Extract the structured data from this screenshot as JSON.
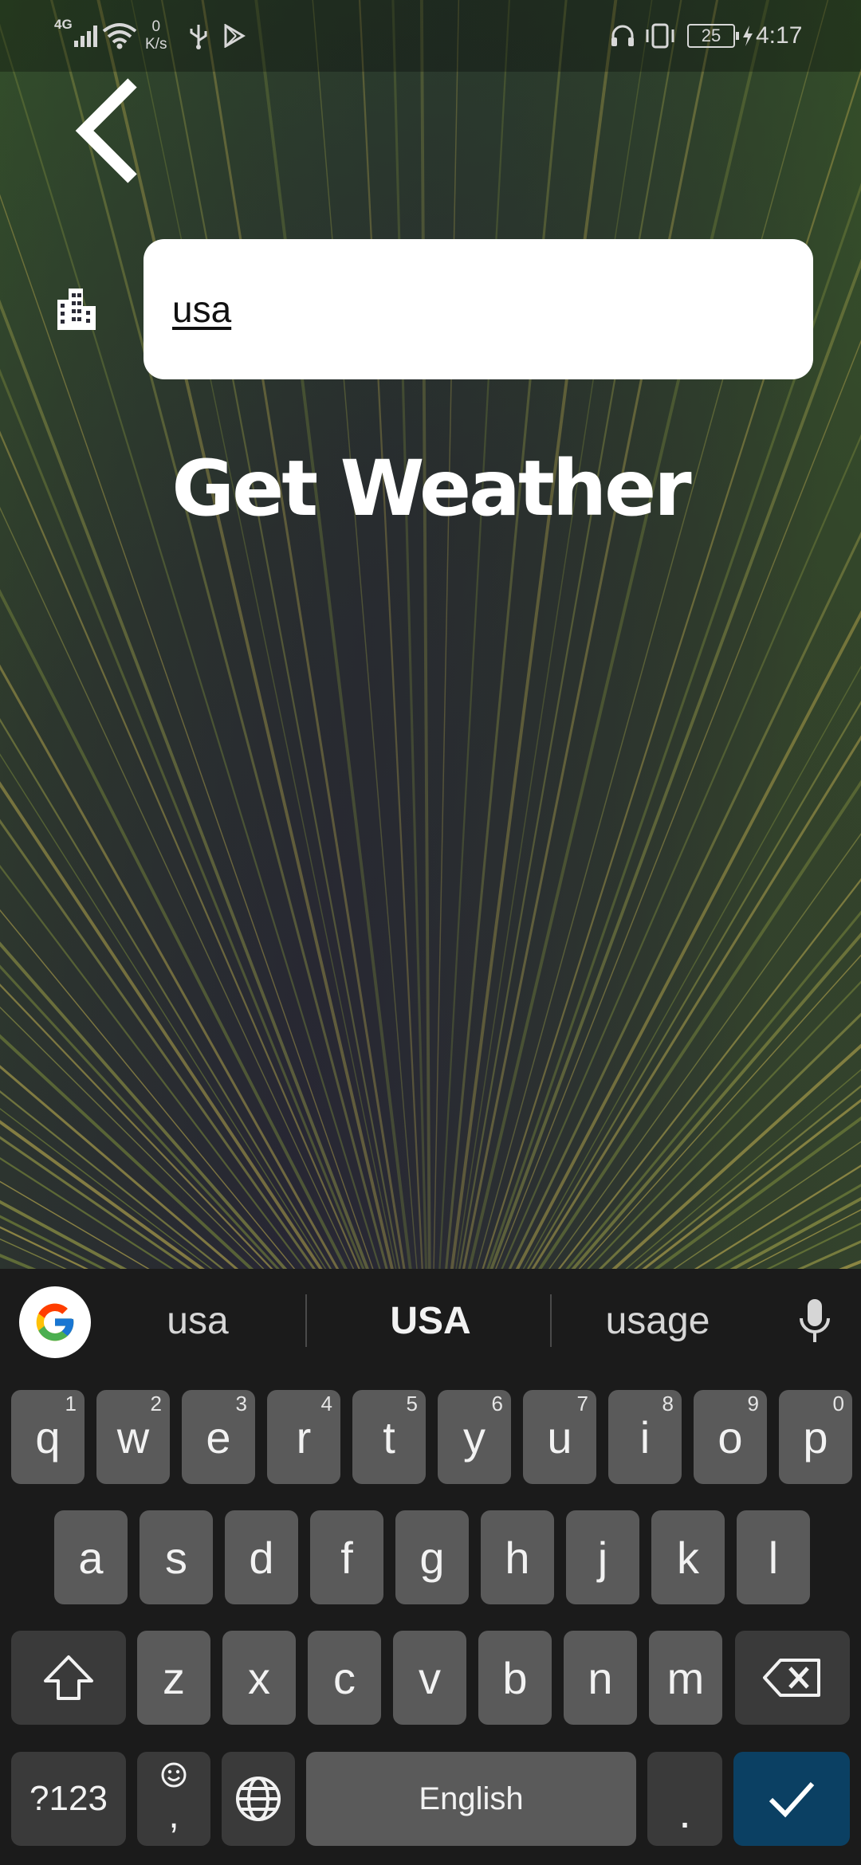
{
  "status_bar": {
    "network": "4G",
    "speed_value": "0",
    "speed_unit": "K/s",
    "battery": "25",
    "time": "4:17"
  },
  "app": {
    "city_input_value": "usa",
    "get_weather_label": "Get Weather"
  },
  "keyboard": {
    "suggestions": [
      "usa",
      "USA",
      "usage"
    ],
    "row1": [
      {
        "k": "q",
        "h": "1"
      },
      {
        "k": "w",
        "h": "2"
      },
      {
        "k": "e",
        "h": "3"
      },
      {
        "k": "r",
        "h": "4"
      },
      {
        "k": "t",
        "h": "5"
      },
      {
        "k": "y",
        "h": "6"
      },
      {
        "k": "u",
        "h": "7"
      },
      {
        "k": "i",
        "h": "8"
      },
      {
        "k": "o",
        "h": "9"
      },
      {
        "k": "p",
        "h": "0"
      }
    ],
    "row2": [
      "a",
      "s",
      "d",
      "f",
      "g",
      "h",
      "j",
      "k",
      "l"
    ],
    "row3": [
      "z",
      "x",
      "c",
      "v",
      "b",
      "n",
      "m"
    ],
    "symbols_label": "?123",
    "comma_label": ",",
    "space_label": "English",
    "period_label": ".",
    "colors": {
      "keyboard_bg": "#1b1b1b",
      "key": "#5a5a5a",
      "function_key": "#3a3a3a",
      "enter_key": "#0b4063"
    }
  }
}
